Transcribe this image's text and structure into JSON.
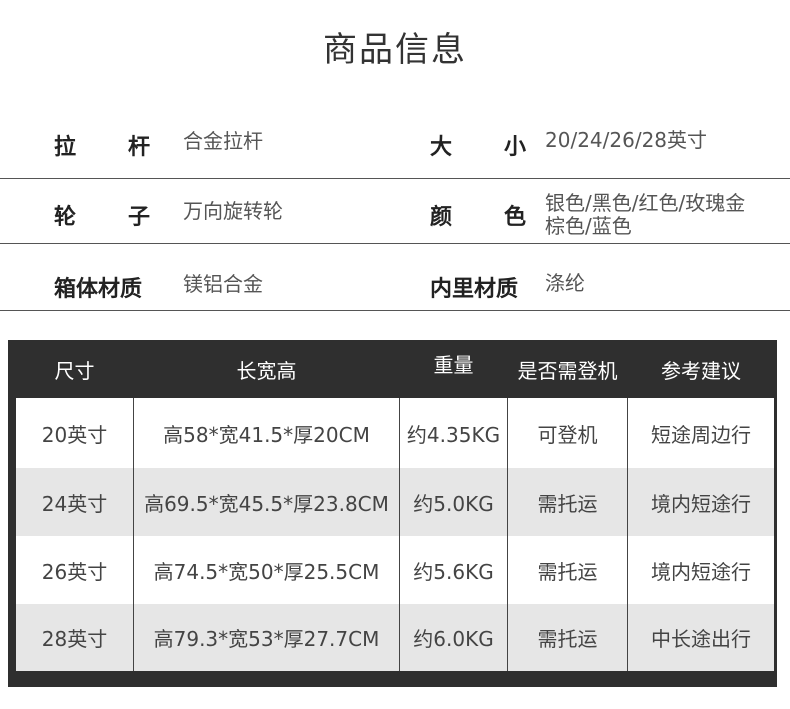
{
  "title": "商品信息",
  "info": {
    "rows": [
      {
        "left_label": [
          "拉",
          "杆"
        ],
        "left_value": "合金拉杆",
        "right_label": [
          "大",
          "小"
        ],
        "right_value": "20/24/26/28英寸"
      },
      {
        "left_label": [
          "轮",
          "子"
        ],
        "left_value": "万向旋转轮",
        "right_label": [
          "颜",
          "色"
        ],
        "right_value_line1": "银色/黑色/红色/玫瑰金",
        "right_value_line2": "棕色/蓝色"
      },
      {
        "left_label_full": "箱体材质",
        "left_value": "镁铝合金",
        "right_label_full": "内里材质",
        "right_value": "涤纶"
      }
    ]
  },
  "table": {
    "headers": [
      "尺寸",
      "长宽高",
      "重量",
      "是否需登机",
      "参考建议"
    ],
    "rows": [
      [
        "20英寸",
        "高58*宽41.5*厚20CM",
        "约4.35KG",
        "可登机",
        "短途周边行"
      ],
      [
        "24英寸",
        "高69.5*宽45.5*厚23.8CM",
        "约5.0KG",
        "需托运",
        "境内短途行"
      ],
      [
        "26英寸",
        "高74.5*宽50*厚25.5CM",
        "约5.6KG",
        "需托运",
        "境内短途行"
      ],
      [
        "28英寸",
        "高79.3*宽53*厚27.7CM",
        "约6.0KG",
        "需托运",
        "中长途出行"
      ]
    ],
    "colors": {
      "header_bg": "#2f2f2f",
      "row_white": "#ffffff",
      "row_gray": "#e6e6e6"
    }
  }
}
